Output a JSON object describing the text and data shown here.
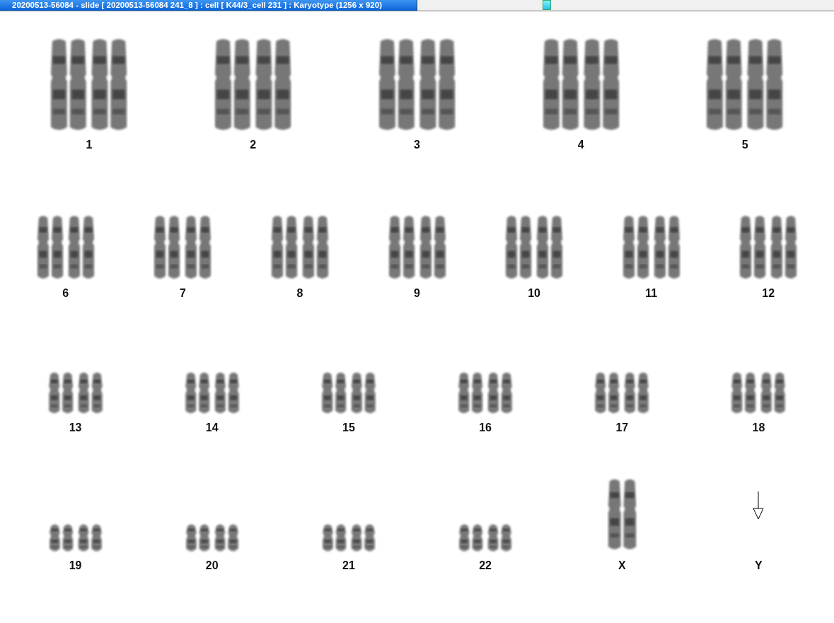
{
  "window": {
    "title": "20200513-56084 - slide [ 20200513-56084 241_8 ] : cell [ K44/3_cell 231 ] : Karyotype  (1256 x 920)"
  },
  "karyotype_rows": [
    {
      "items": [
        {
          "label": "1",
          "kind": "pair"
        },
        {
          "label": "2",
          "kind": "pair"
        },
        {
          "label": "3",
          "kind": "pair"
        },
        {
          "label": "4",
          "kind": "pair"
        },
        {
          "label": "5",
          "kind": "pair"
        }
      ]
    },
    {
      "items": [
        {
          "label": "6",
          "kind": "pair"
        },
        {
          "label": "7",
          "kind": "pair"
        },
        {
          "label": "8",
          "kind": "pair"
        },
        {
          "label": "9",
          "kind": "pair"
        },
        {
          "label": "10",
          "kind": "pair"
        },
        {
          "label": "11",
          "kind": "pair"
        },
        {
          "label": "12",
          "kind": "pair"
        }
      ]
    },
    {
      "items": [
        {
          "label": "13",
          "kind": "pair"
        },
        {
          "label": "14",
          "kind": "pair"
        },
        {
          "label": "15",
          "kind": "pair"
        },
        {
          "label": "16",
          "kind": "pair"
        },
        {
          "label": "17",
          "kind": "pair"
        },
        {
          "label": "18",
          "kind": "pair"
        }
      ]
    },
    {
      "items": [
        {
          "label": "19",
          "kind": "pair"
        },
        {
          "label": "20",
          "kind": "pair"
        },
        {
          "label": "21",
          "kind": "pair"
        },
        {
          "label": "22",
          "kind": "pair"
        },
        {
          "label": "X",
          "kind": "single"
        },
        {
          "label": "Y",
          "kind": "missing"
        }
      ]
    }
  ]
}
